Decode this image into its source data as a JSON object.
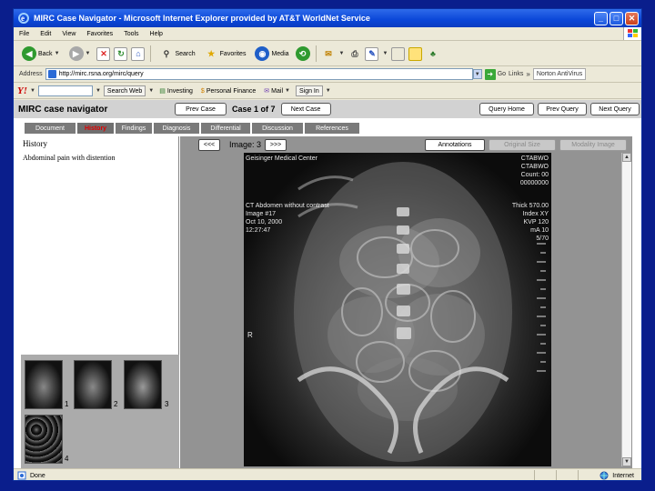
{
  "browser": {
    "title": "MIRC Case Navigator - Microsoft Internet Explorer provided by AT&T WorldNet Service",
    "window_buttons": {
      "minimize": "_",
      "maximize": "□",
      "close": "✕"
    },
    "menu": [
      "File",
      "Edit",
      "View",
      "Favorites",
      "Tools",
      "Help"
    ],
    "toolbar": {
      "back": "Back",
      "search": "Search",
      "favorites": "Favorites",
      "media": "Media"
    },
    "address": {
      "label": "Address",
      "url": "http://mirc.rsna.org/mirc/query",
      "go": "Go",
      "links": "Links",
      "norton": "Norton AntiVirus"
    },
    "yahoo": {
      "logo": "Y!",
      "search_web": "Search Web",
      "investing": "Investing",
      "personal_finance": "Personal Finance",
      "mail": "Mail",
      "sign_in": "Sign In"
    },
    "status": {
      "text": "Done",
      "zone": "Internet"
    }
  },
  "mirc": {
    "title": "MIRC case navigator",
    "prev_case": "Prev Case",
    "case_label": "Case 1 of 7",
    "next_case": "Next Case",
    "query_home": "Query Home",
    "prev_query": "Prev Query",
    "next_query": "Next Query",
    "tabs": [
      "Document",
      "History",
      "Findings",
      "Diagnosis",
      "Differential",
      "Discussion",
      "References"
    ],
    "active_tab": "History",
    "section_title": "History",
    "history_text": "Abdominal pain with distention",
    "thumbnails": [
      "1",
      "2",
      "3",
      "4"
    ]
  },
  "viewer": {
    "prev_btn": "<<<",
    "image_label": "Image: 3",
    "next_btn": ">>>",
    "annotations": "Annotations",
    "original_size": "Original Size",
    "modality_image": "Modality Image",
    "overlay": {
      "top_left_1": "Geisinger Medical Center",
      "left_1": "CT Abdomen without contrast",
      "left_2": "Image #17",
      "left_3": "Oct 10, 2000",
      "left_4": "12:27:47",
      "right_1": "CTABWO",
      "right_2": "CTABWO",
      "right_3": "Count: 00",
      "right_4": "00000000",
      "right_5": "Thick 570.00",
      "right_6": "Index XY",
      "right_7": "KVP 120",
      "right_8": "mA 10",
      "right_9": "5/70",
      "marker": "R"
    }
  }
}
